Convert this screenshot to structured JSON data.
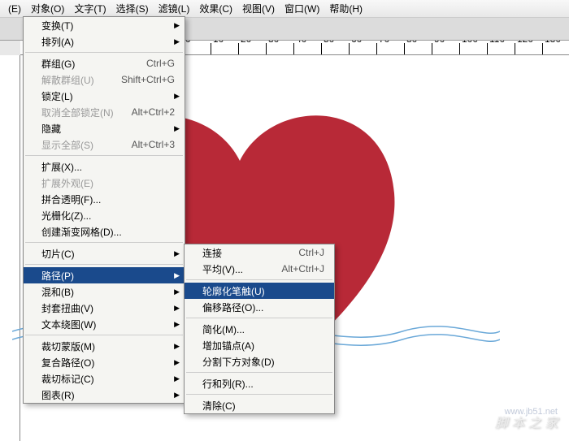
{
  "menubar": {
    "items": [
      "(E)",
      "对象(O)",
      "文字(T)",
      "选择(S)",
      "滤镜(L)",
      "效果(C)",
      "视图(V)",
      "窗口(W)",
      "帮助(H)"
    ]
  },
  "menu1": [
    {
      "label": "变换(T)",
      "sub": true
    },
    {
      "label": "排列(A)",
      "sub": true
    },
    {
      "sep": true
    },
    {
      "label": "群组(G)",
      "shortcut": "Ctrl+G"
    },
    {
      "label": "解散群组(U)",
      "shortcut": "Shift+Ctrl+G",
      "disabled": true
    },
    {
      "label": "锁定(L)",
      "sub": true
    },
    {
      "label": "取消全部锁定(N)",
      "shortcut": "Alt+Ctrl+2",
      "disabled": true
    },
    {
      "label": "隐藏",
      "sub": true
    },
    {
      "label": "显示全部(S)",
      "shortcut": "Alt+Ctrl+3",
      "disabled": true
    },
    {
      "sep": true
    },
    {
      "label": "扩展(X)..."
    },
    {
      "label": "扩展外观(E)",
      "disabled": true
    },
    {
      "label": "拼合透明(F)..."
    },
    {
      "label": "光栅化(Z)..."
    },
    {
      "label": "创建渐变网格(D)..."
    },
    {
      "sep": true
    },
    {
      "label": "切片(C)",
      "sub": true
    },
    {
      "sep": true
    },
    {
      "label": "路径(P)",
      "sub": true,
      "hl": true
    },
    {
      "label": "混和(B)",
      "sub": true
    },
    {
      "label": "封套扭曲(V)",
      "sub": true
    },
    {
      "label": "文本绕图(W)",
      "sub": true
    },
    {
      "sep": true
    },
    {
      "label": "裁切蒙版(M)",
      "sub": true
    },
    {
      "label": "复合路径(O)",
      "sub": true
    },
    {
      "label": "裁切标记(C)",
      "sub": true
    },
    {
      "label": "图表(R)",
      "sub": true
    }
  ],
  "menu2": [
    {
      "label": "连接",
      "shortcut": "Ctrl+J"
    },
    {
      "label": "平均(V)...",
      "shortcut": "Alt+Ctrl+J"
    },
    {
      "sep": true
    },
    {
      "label": "轮廓化笔触(U)",
      "hl": true
    },
    {
      "label": "偏移路径(O)..."
    },
    {
      "sep": true
    },
    {
      "label": "简化(M)..."
    },
    {
      "label": "增加锚点(A)"
    },
    {
      "label": "分割下方对象(D)"
    },
    {
      "sep": true
    },
    {
      "label": "行和列(R)..."
    },
    {
      "sep": true
    },
    {
      "label": "清除(C)"
    }
  ],
  "ruler_ticks": [
    0,
    10,
    20,
    30,
    40,
    50,
    60,
    70,
    80,
    90,
    100,
    110,
    120,
    130
  ],
  "watermark": "脚 本 之 家",
  "watermark_url": "www.jb51.net"
}
